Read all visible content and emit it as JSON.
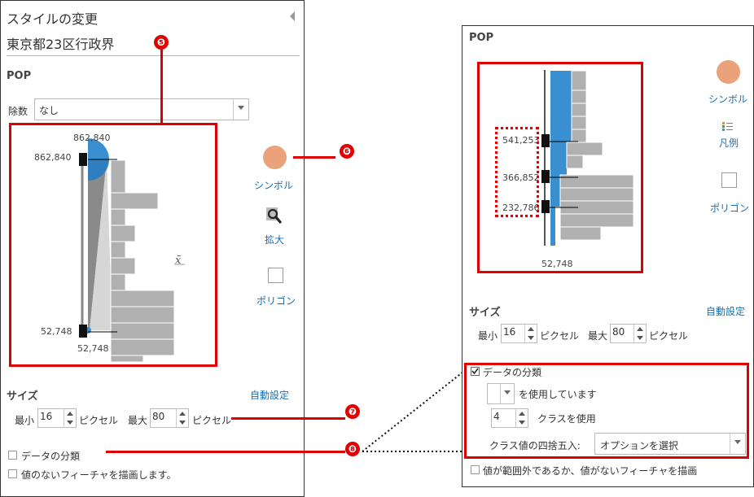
{
  "left_panel": {
    "header": "スタイルの変更",
    "layer_name": "東京都23区行政界",
    "field_title": "POP",
    "divide_label": "除数",
    "divide_value": "なし",
    "hist_top_value": "862,840",
    "hist_top_value_2": "862,840",
    "hist_bottom_value": "52,748",
    "hist_bottom_value_2": "52,748",
    "xbar": "x̄",
    "symbol_label": "シンボル",
    "zoom_label": "拡大",
    "polygon_label": "ポリゴン",
    "size_label": "サイズ",
    "auto_label": "自動設定",
    "min_label": "最小",
    "min_value": "16",
    "min_unit": "ピクセル",
    "max_label": "最大",
    "max_value": "80",
    "max_unit": "ピクセル",
    "classify_label": "データの分類",
    "nodata_label": "値のないフィーチャを描画します。"
  },
  "right_panel": {
    "field_title": "POP",
    "break_1": "541,253",
    "break_2": "366,852",
    "break_3": "232,786",
    "bottom_value": "52,748",
    "symbol_label": "シンボル",
    "legend_label": "凡例",
    "polygon_label": "ポリゴン",
    "size_label": "サイズ",
    "auto_label": "自動設定",
    "min_label": "最小",
    "min_value": "16",
    "min_unit": "ピクセル",
    "max_label": "最大",
    "max_value": "80",
    "max_unit": "ピクセル",
    "classify_label": "データの分類",
    "using_label": "を使用しています",
    "class_count": "4",
    "class_label": "クラスを使用",
    "round_label": "クラス値の四捨五入:",
    "round_select": "オプションを選択",
    "outside_label": "値が範囲外であるか、値がないフィーチャを描画"
  },
  "callouts": [
    "❺",
    "❻",
    "❼",
    "❽"
  ],
  "colors": {
    "accent_red": "#e00000",
    "symbol_orange": "#e9a27a",
    "bar_blue": "#3a8fd1",
    "bar_gray": "#b0b0b0",
    "link_blue": "#1a6fb0"
  }
}
